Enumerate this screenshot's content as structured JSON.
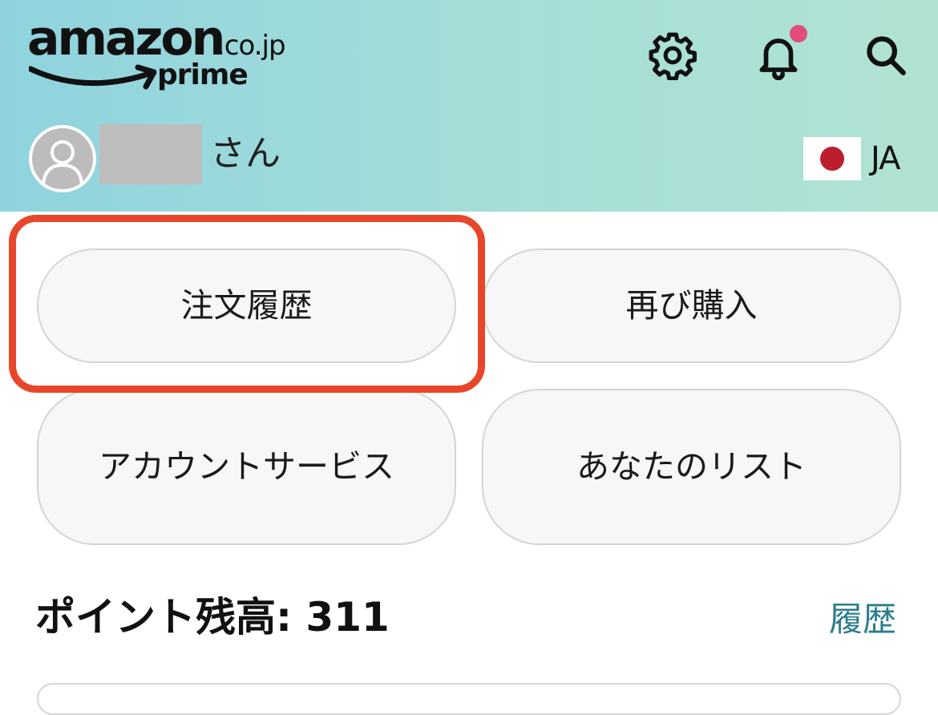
{
  "header": {
    "logo": {
      "wordmark": "amazon",
      "domain": ".co.jp",
      "tier": "prime"
    },
    "icons": [
      "gear-icon",
      "bell-icon",
      "search-icon"
    ],
    "notification_dot_color": "#e34d79"
  },
  "user": {
    "suffix": "さん",
    "language": "JA"
  },
  "buttons": {
    "order_history": "注文履歴",
    "buy_again": "再び購入",
    "account_service": "アカウントサービス",
    "your_lists": "あなたのリスト"
  },
  "points": {
    "label": "ポイント残高: 311",
    "history_link": "履歴"
  },
  "colors": {
    "header_gradient_start": "#8fd3de",
    "header_gradient_end": "#b1e3d4",
    "highlight": "#e8462a",
    "link": "#2b7d8c"
  }
}
